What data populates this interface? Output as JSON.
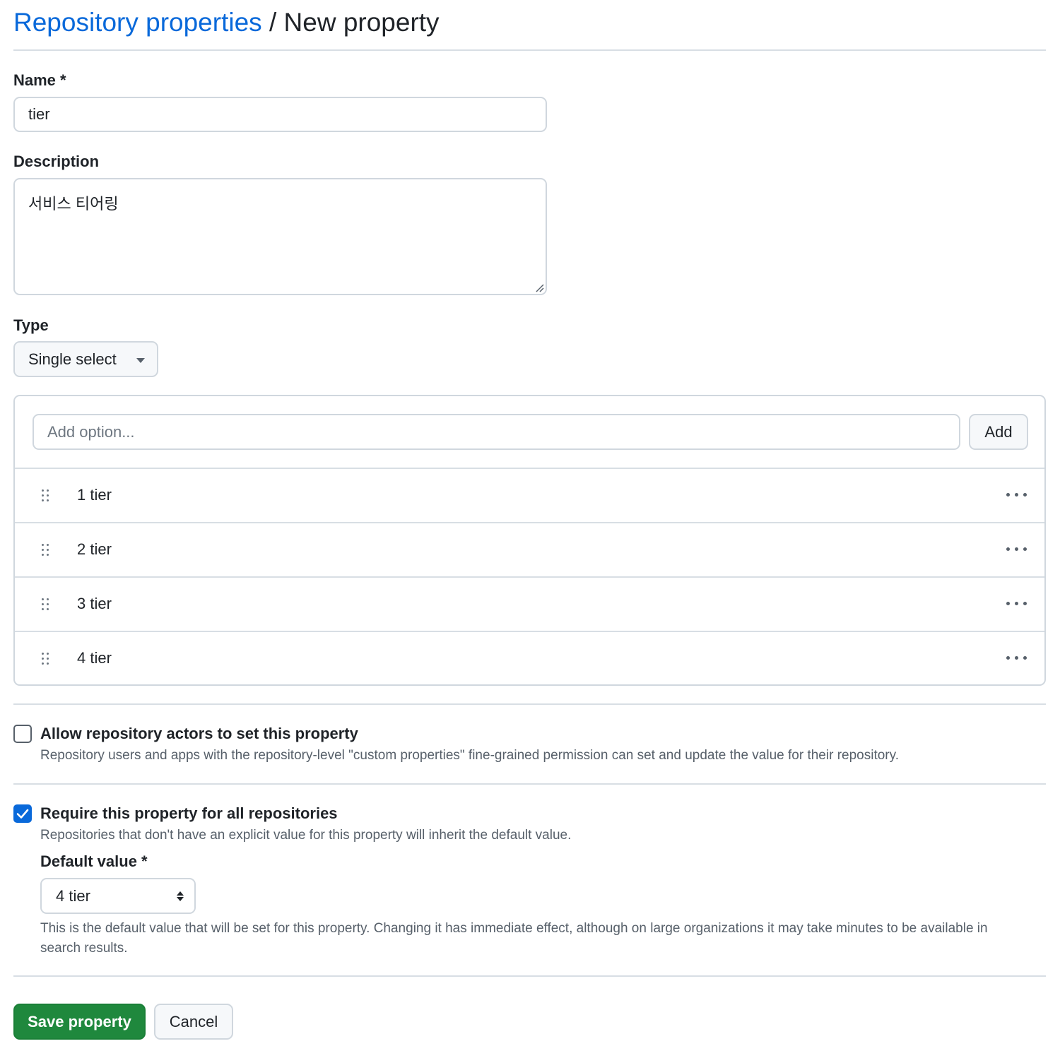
{
  "header": {
    "breadcrumb_link": "Repository properties",
    "separator": "/",
    "current_page": "New property"
  },
  "name_field": {
    "label": "Name *",
    "value": "tier"
  },
  "description_field": {
    "label": "Description",
    "value": "서비스 티어링"
  },
  "type_field": {
    "label": "Type",
    "selected": "Single select",
    "icon": "triangle-down-icon"
  },
  "options": {
    "add_placeholder": "Add option...",
    "add_button_label": "Add",
    "items": [
      {
        "label": "1 tier"
      },
      {
        "label": "2 tier"
      },
      {
        "label": "3 tier"
      },
      {
        "label": "4 tier"
      }
    ]
  },
  "allow_actors": {
    "checked": false,
    "title": "Allow repository actors to set this property",
    "description": "Repository users and apps with the repository-level \"custom properties\" fine-grained permission can set and update the value for their repository."
  },
  "require_property": {
    "checked": true,
    "title": "Require this property for all repositories",
    "description": "Repositories that don't have an explicit value for this property will inherit the default value.",
    "default_label": "Default value *",
    "default_value": "4 tier",
    "help_text": "This is the default value that will be set for this property. Changing it has immediate effect, although on large organizations it may take minutes to be available in search results."
  },
  "footer": {
    "save_label": "Save property",
    "cancel_label": "Cancel"
  },
  "colors": {
    "link": "#0969da",
    "primary_button": "#1f883d",
    "checkbox_checked": "#0969da",
    "border": "#d0d7de",
    "muted_text": "#57606a"
  }
}
